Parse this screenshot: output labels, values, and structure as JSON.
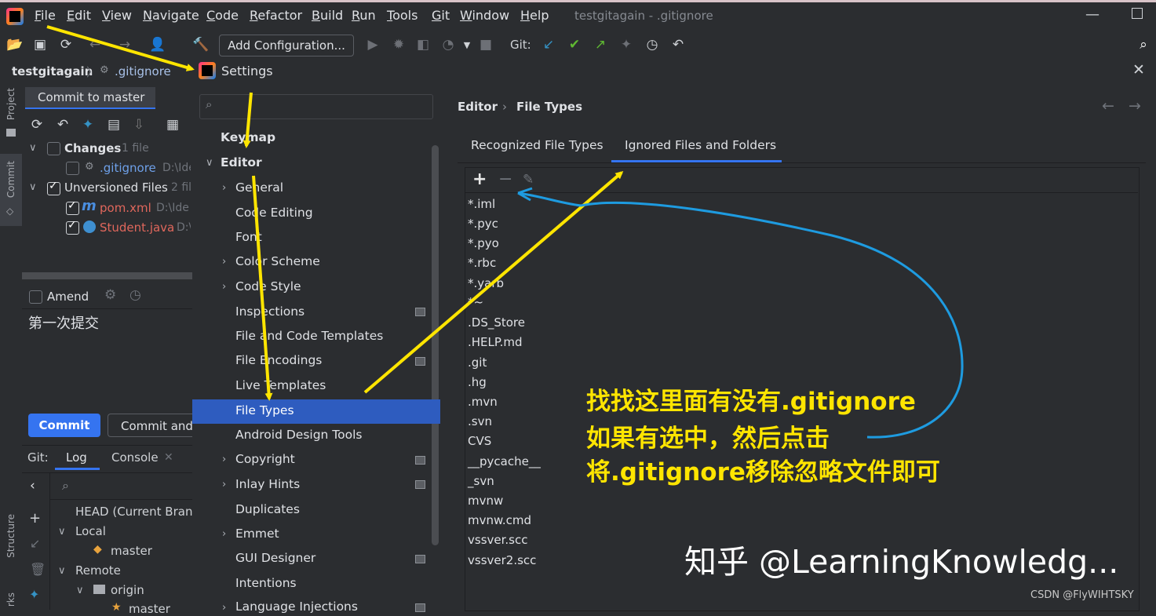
{
  "menubar": {
    "items": [
      "File",
      "Edit",
      "View",
      "Navigate",
      "Code",
      "Refactor",
      "Build",
      "Run",
      "Tools",
      "Git",
      "Window",
      "Help"
    ],
    "window_title": "testgitagain - .gitignore"
  },
  "toolbar": {
    "add_configuration": "Add Configuration...",
    "git_label": "Git:"
  },
  "breadcrumb": {
    "project": "testgitagain",
    "file": ".gitignore"
  },
  "left_stripe": {
    "project": "Project",
    "commit": "Commit",
    "structure": "Structure",
    "bookmarks": "rks"
  },
  "commit_panel": {
    "tab": "Commit to master",
    "changes_label": "Changes",
    "changes_count": "1 file",
    "gitignore_file": ".gitignore",
    "gitignore_path": "D:\\Ide",
    "unversioned_label": "Unversioned Files",
    "unversioned_count": "2 fil",
    "pom_file": "pom.xml",
    "pom_path": "D:\\Ide",
    "student_file": "Student.java",
    "student_path": "D:\\",
    "amend": "Amend",
    "message": "第一次提交",
    "commit_button": "Commit",
    "commit_and_button": "Commit and"
  },
  "git_panel": {
    "git_label": "Git:",
    "log_tab": "Log",
    "console_tab": "Console",
    "head": "HEAD (Current Branc",
    "local": "Local",
    "master": "master",
    "remote": "Remote",
    "origin": "origin",
    "origin_master": "master"
  },
  "settings": {
    "title": "Settings",
    "nav": {
      "keymap": "Keymap",
      "editor": "Editor",
      "general": "General",
      "code_editing": "Code Editing",
      "font": "Font",
      "color_scheme": "Color Scheme",
      "code_style": "Code Style",
      "inspections": "Inspections",
      "file_code_templates": "File and Code Templates",
      "file_encodings": "File Encodings",
      "live_templates": "Live Templates",
      "file_types": "File Types",
      "android_design_tools": "Android Design Tools",
      "copyright": "Copyright",
      "inlay_hints": "Inlay Hints",
      "duplicates": "Duplicates",
      "emmet": "Emmet",
      "gui_designer": "GUI Designer",
      "intentions": "Intentions",
      "language_injections": "Language Injections"
    },
    "breadcrumb": {
      "parent": "Editor",
      "current": "File Types"
    },
    "tabs": {
      "recognized": "Recognized File Types",
      "ignored": "Ignored Files and Folders"
    },
    "ignored_list": [
      "*.iml",
      "*.pyc",
      "*.pyo",
      "*.rbc",
      "*.yarb",
      "*~",
      ".DS_Store",
      ".HELP.md",
      ".git",
      ".hg",
      ".mvn",
      ".svn",
      "CVS",
      "__pycache__",
      "_svn",
      "mvnw",
      "mvnw.cmd",
      "vssver.scc",
      "vssver2.scc"
    ]
  },
  "annotation": {
    "line1": "找找这里面有没有.gitignore",
    "line2": "如果有选中，然后点击",
    "line3": "将.gitignore移除忽略文件即可"
  },
  "watermark": "知乎 @LearningKnowledg...",
  "csdn": "CSDN @FlyWIHTSKY",
  "colors": {
    "accent": "#3574f0",
    "selection": "#2e5cbf",
    "annotation": "#ffe500",
    "curve": "#1e9be0"
  }
}
